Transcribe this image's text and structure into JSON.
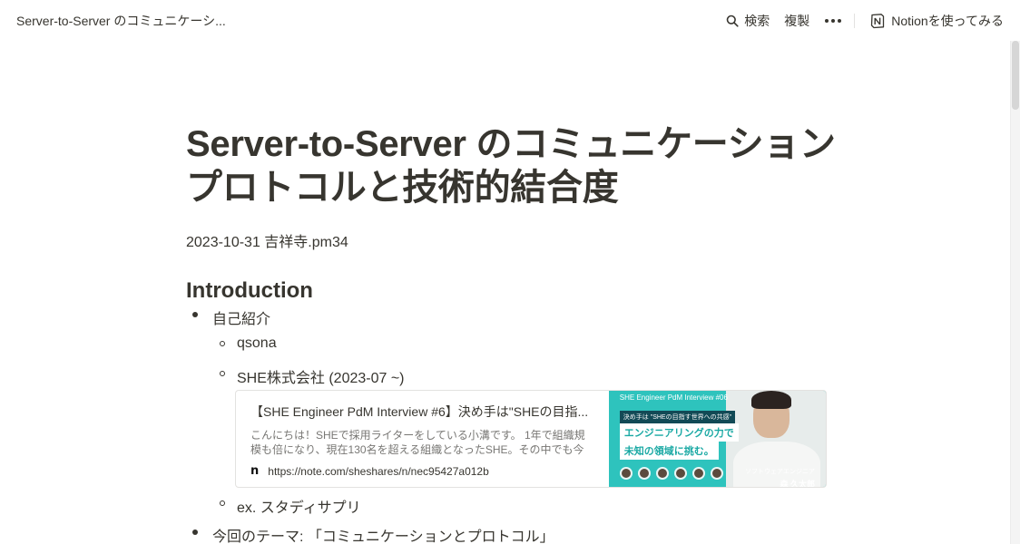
{
  "topbar": {
    "page_title": "Server-to-Server のコミュニケーシ...",
    "search_label": "検索",
    "duplicate_label": "複製",
    "try_notion_label": "Notionを使ってみる"
  },
  "page": {
    "title": "Server-to-Server のコミュニケーションプロトコルと技術的結合度",
    "meta": "2023-10-31 吉祥寺.pm34",
    "section_heading": "Introduction"
  },
  "list": {
    "item1": "自己紹介",
    "item1_sub1": "qsona",
    "item1_sub2": "SHE株式会社 (2023-07 ~)",
    "item1_sub3": "ex. スタディサプリ",
    "item2": "今回のテーマ: 「コミュニケーションとプロトコル」"
  },
  "bookmark": {
    "title": "【SHE Engineer PdM Interview #6】決め手は\"SHEの目指...",
    "description": "こんにちは！SHEで採用ライターをしている小溝です。 1年で組織規模も倍になり、現在130名を超える組織となったSHE。その中でも今回は",
    "url": "https://note.com/sheshares/n/nec95427a012b",
    "image": {
      "tag": "SHE Engineer PdM Interview #06",
      "subtitle": "決め手は \"SHEの目指す世界への共感\"",
      "headline_line1": "エンジニアリングの力で",
      "headline_line2": "未知の領域に挑む。",
      "caption": "ソフトウェアエンジニア",
      "name": "森 久太郎"
    }
  },
  "colors": {
    "text": "#37352f",
    "muted": "#787774",
    "image_bg": "#2ec3bd"
  }
}
